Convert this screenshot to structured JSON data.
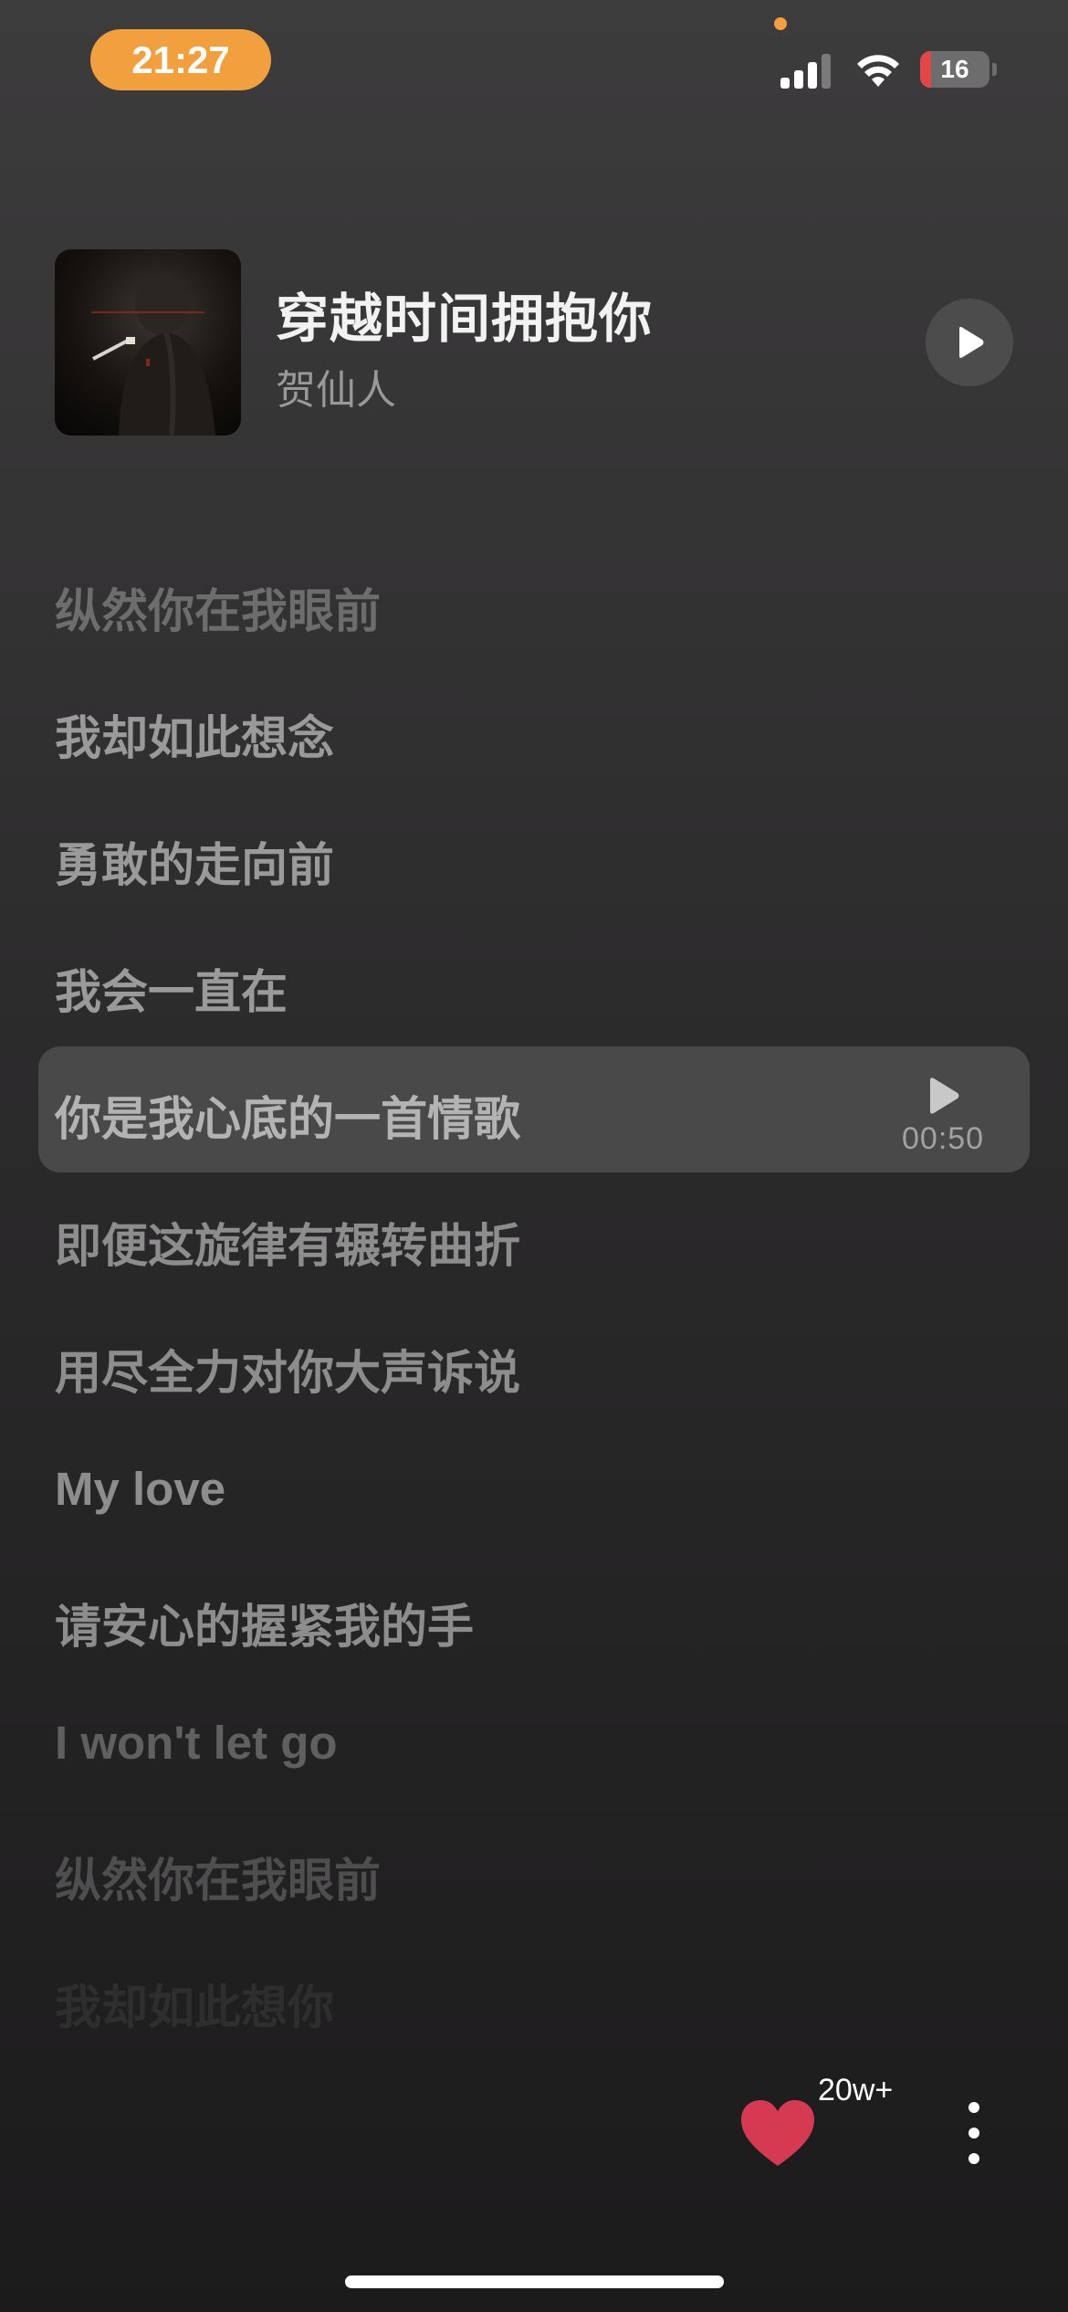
{
  "status_bar": {
    "time": "21:27",
    "battery_level": "16",
    "accent_color": "#f2a03d",
    "battery_low_color": "#e24646"
  },
  "song": {
    "title": "穿越时间拥抱你",
    "artist": "贺仙人",
    "play_icon": "play-icon"
  },
  "lyrics": [
    {
      "text": "纵然你在我眼前"
    },
    {
      "text": "我却如此想念"
    },
    {
      "text": "勇敢的走向前"
    },
    {
      "text": "我会一直在"
    },
    {
      "text": "你是我心底的一首情歌",
      "current": true
    },
    {
      "text": "即便这旋律有辗转曲折"
    },
    {
      "text": "用尽全力对你大声诉说"
    },
    {
      "text": "My love"
    },
    {
      "text": "请安心的握紧我的手"
    },
    {
      "text": "I won't let go"
    },
    {
      "text": "纵然你在我眼前"
    },
    {
      "text": "我却如此想你"
    }
  ],
  "current_line": {
    "timestamp": "00:50"
  },
  "actions": {
    "like_count": "20w+",
    "like_color": "#d63a52",
    "heart_icon": "heart-icon",
    "more_icon": "more-vertical-icon"
  }
}
